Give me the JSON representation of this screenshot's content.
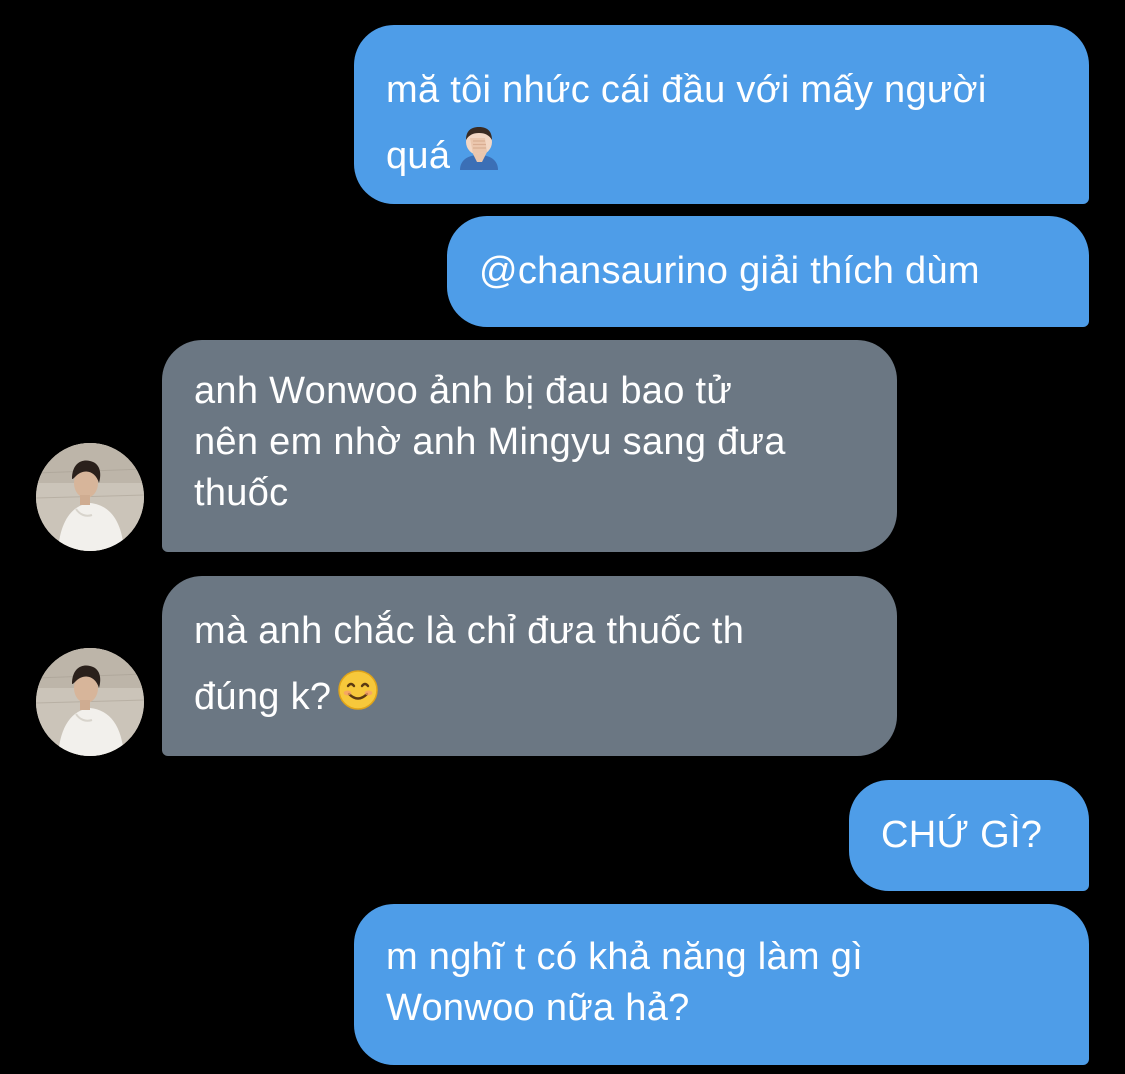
{
  "colors": {
    "background": "#000000",
    "outgoing_bubble": "#4e9de8",
    "incoming_bubble": "#6b7783",
    "text": "#ffffff"
  },
  "messages": [
    {
      "direction": "outgoing",
      "lines": [
        "mă tôi nhức cái đầu với mấy người",
        "quá"
      ],
      "emoji": "person-facepalming-emoji"
    },
    {
      "direction": "outgoing",
      "lines": [
        "@chansaurino giải thích dùm"
      ]
    },
    {
      "direction": "incoming",
      "lines": [
        "anh Wonwoo ảnh bị đau bao tử",
        "nên em nhờ anh Mingyu sang đưa",
        "thuốc"
      ],
      "avatar": "avatar-icon"
    },
    {
      "direction": "incoming",
      "lines": [
        "mà anh chắc là chỉ đưa thuốc th",
        "đúng k?"
      ],
      "emoji": "smiling-face-emoji",
      "avatar": "avatar-icon"
    },
    {
      "direction": "outgoing",
      "lines": [
        "CHỨ GÌ?"
      ]
    },
    {
      "direction": "outgoing",
      "lines": [
        "m nghĩ t có khả năng làm gì",
        "Wonwoo nữa hả?"
      ]
    }
  ]
}
